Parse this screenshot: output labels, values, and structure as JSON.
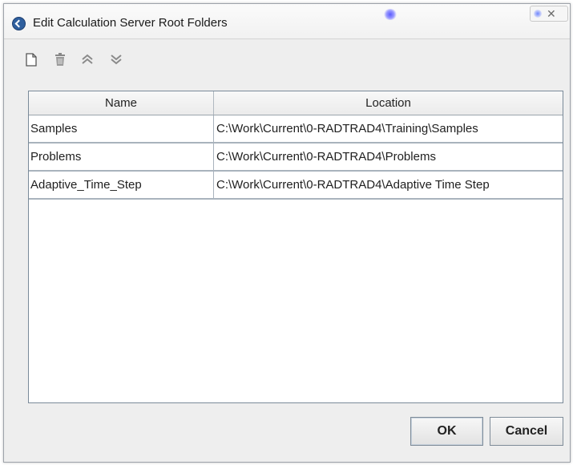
{
  "window": {
    "title": "Edit Calculation Server Root Folders",
    "close_glyph": "✕",
    "app_icon": "app-logo-icon"
  },
  "toolbar": {
    "buttons": [
      {
        "id": "new",
        "icon": "new-document-icon"
      },
      {
        "id": "delete",
        "icon": "trash-icon"
      },
      {
        "id": "move_up",
        "icon": "double-chevron-up-icon"
      },
      {
        "id": "move_down",
        "icon": "double-chevron-down-icon"
      }
    ]
  },
  "table": {
    "columns": [
      "Name",
      "Location"
    ],
    "rows": [
      {
        "name": "Samples",
        "location": "C:\\Work\\Current\\0-RADTRAD4\\Training\\Samples"
      },
      {
        "name": "Problems",
        "location": "C:\\Work\\Current\\0-RADTRAD4\\Problems"
      },
      {
        "name": "Adaptive_Time_Step",
        "location": "C:\\Work\\Current\\0-RADTRAD4\\Adaptive Time Step"
      }
    ]
  },
  "actions": {
    "ok_label": "OK",
    "cancel_label": "Cancel"
  },
  "colors": {
    "window_bg": "#eeeeee",
    "table_border": "#7a8a99",
    "app_icon": "#2f5f9e"
  }
}
